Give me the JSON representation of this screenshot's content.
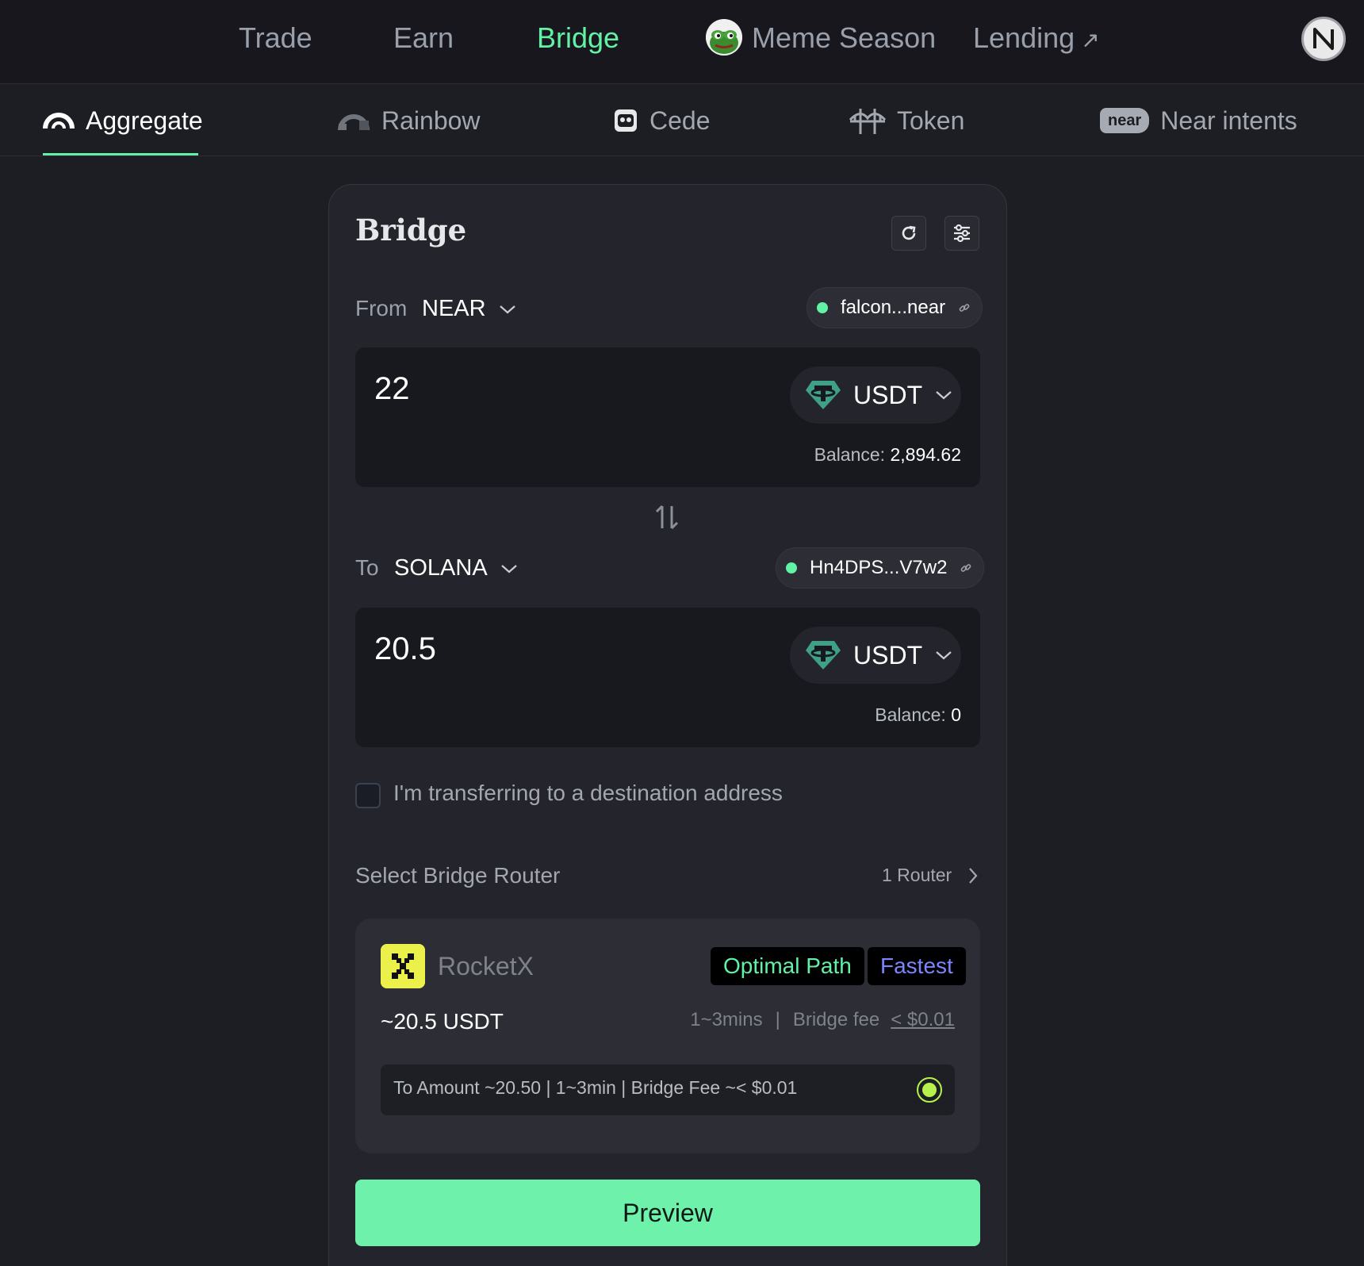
{
  "topnav": {
    "items": [
      {
        "label": "Trade"
      },
      {
        "label": "Earn"
      },
      {
        "label": "Bridge"
      },
      {
        "label": "Meme Season"
      },
      {
        "label": "Lending"
      }
    ],
    "external_glyph": "↗",
    "active": "Bridge",
    "accent_color": "#62f2a6"
  },
  "subnav": {
    "tabs": [
      {
        "label": "Aggregate",
        "icon": "rainbow-arc-icon"
      },
      {
        "label": "Rainbow",
        "icon": "rainbow-logo-icon"
      },
      {
        "label": "Cede",
        "icon": "cede-logo-icon"
      },
      {
        "label": "Token",
        "icon": "bridge-icon"
      },
      {
        "label": "Near intents",
        "icon": "near-badge-icon",
        "badge": "near"
      }
    ],
    "active": "Aggregate"
  },
  "bridge": {
    "title": "Bridge",
    "from": {
      "label": "From",
      "chain": "NEAR",
      "address": "falcon...near",
      "amount": "22",
      "token": "USDT",
      "balance_label": "Balance:",
      "balance_value": "2,894.62"
    },
    "to": {
      "label": "To",
      "chain": "SOLANA",
      "address": "Hn4DPS...V7w2",
      "amount": "20.5",
      "token": "USDT",
      "balance_label": "Balance:",
      "balance_value": "0"
    },
    "destination_checkbox": {
      "label": "I'm transferring to a destination address",
      "checked": false
    },
    "router_section": {
      "label": "Select Bridge Router",
      "count": "1 Router"
    },
    "router": {
      "name": "RocketX",
      "badges": [
        "Optimal Path",
        "Fastest"
      ],
      "amount": "~20.5 USDT",
      "time": "1~3mins",
      "fee_label": "Bridge fee",
      "fee_value": "< $0.01",
      "route_summary": "To Amount ~20.50   | 1~3min |   Bridge Fee ~< $0.01",
      "selected": true
    },
    "preview_button": "Preview"
  },
  "colors": {
    "background": "#1d1e24",
    "card": "#24252c",
    "accent": "#62f2a6",
    "fastest": "#7a86ff",
    "tether": "#3fa08a"
  }
}
